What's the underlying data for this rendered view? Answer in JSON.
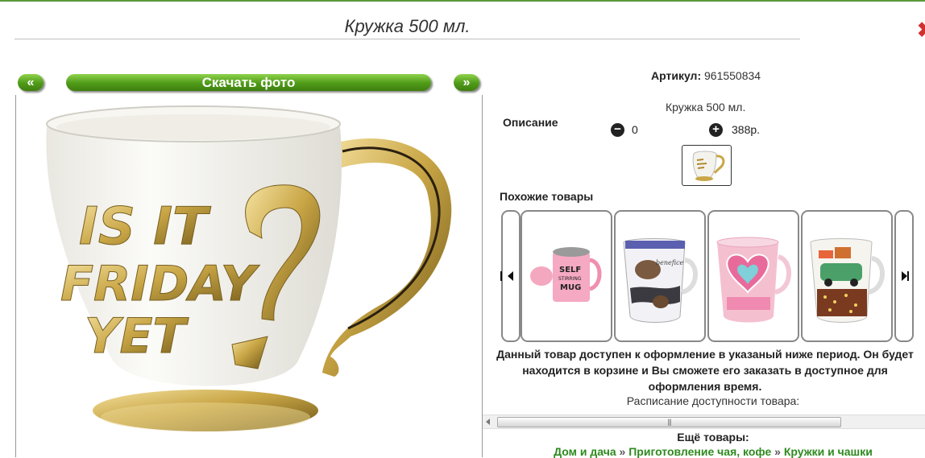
{
  "page": {
    "title": "Кружка 500 мл."
  },
  "gallery": {
    "prev_label": "«",
    "next_label": "»",
    "download_label": "Скачать фото",
    "mug_text": [
      "IS IT",
      "FRIDAY",
      "YET"
    ]
  },
  "product": {
    "article_label": "Артикул:",
    "article_value": "961550834",
    "description_label": "Описание",
    "description_value": "Кружка 500 мл.",
    "quantity": "0",
    "price": "388р."
  },
  "similar": {
    "label": "Похожие товары",
    "items": [
      {
        "name": "self-stirring-mug"
      },
      {
        "name": "mug-blue-print"
      },
      {
        "name": "mug-pink-heart"
      },
      {
        "name": "mug-car-print"
      }
    ],
    "self_mug_text": [
      "SELF",
      "STIRRING",
      "MUG"
    ],
    "brand_text": "benefice"
  },
  "availability": {
    "notice": "Данный товар доступен к оформление в указаный ниже период. Он будет находится в корзине и Вы сможете его заказать в доступное для оформления время.",
    "schedule_label": "Расписание доступности товара:"
  },
  "more": {
    "label": "Ещё товары:",
    "breadcrumbs": [
      "Дом и дача",
      "Приготовление чая, кофе",
      "Кружки и чашки"
    ],
    "separator": "»"
  },
  "colors": {
    "accent_green": "#4f9a18",
    "link_green": "#2e8a1f",
    "gold": "#c9a646"
  }
}
